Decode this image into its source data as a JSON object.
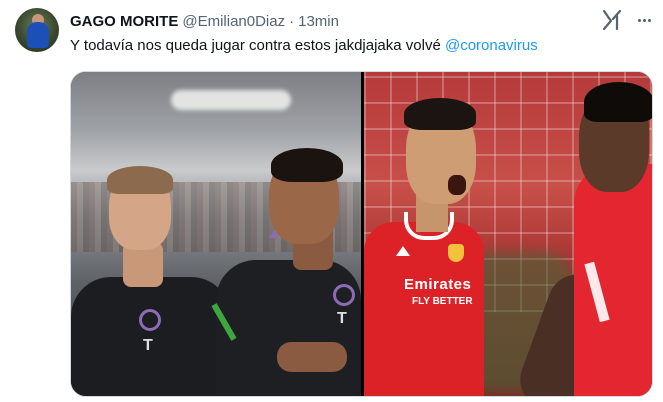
{
  "author": {
    "display_name": "GAGO MORITE",
    "handle": "@Emilian0Diaz",
    "separator": "·",
    "time": "13min"
  },
  "tweet": {
    "text": "Y todavía nos queda jugar contra estos jakdjajaka volvé ",
    "mention": "@coronavirus"
  },
  "media": {
    "left_logo": "T",
    "left_logo_2": "T",
    "right_jersey_line1": "Emirates",
    "right_jersey_line2": "FLY BETTER"
  },
  "icons": {
    "grok": "grok-icon",
    "more": "more-icon"
  },
  "colors": {
    "link": "#1d9bf0",
    "secondary_text": "#536471",
    "primary_text": "#0f1419"
  }
}
